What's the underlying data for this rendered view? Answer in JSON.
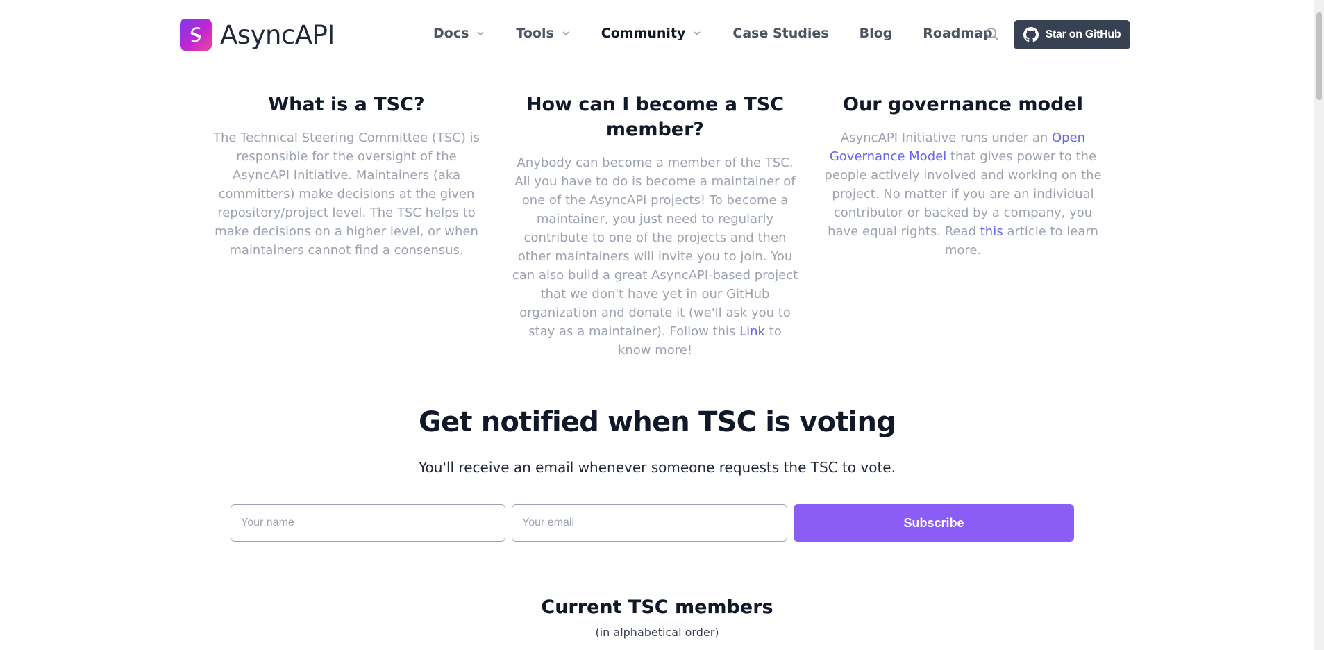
{
  "header": {
    "logo_text": "AsyncAPI",
    "nav": [
      {
        "label": "Docs",
        "dropdown": true
      },
      {
        "label": "Tools",
        "dropdown": true
      },
      {
        "label": "Community",
        "dropdown": true,
        "active": true
      },
      {
        "label": "Case Studies",
        "dropdown": false
      },
      {
        "label": "Blog",
        "dropdown": false
      },
      {
        "label": "Roadmap",
        "dropdown": false
      }
    ],
    "github_button": "Star on GitHub"
  },
  "info": {
    "tsc": {
      "title": "What is a TSC?",
      "body": "The Technical Steering Committee (TSC) is responsible for the oversight of the AsyncAPI Initiative. Maintainers (aka committers) make decisions at the given repository/project level. The TSC helps to make decisions on a higher level, or when maintainers cannot find a consensus."
    },
    "become": {
      "title": "How can I become a TSC member?",
      "body_before": "Anybody can become a member of the TSC. All you have to do is become a maintainer of one of the AsyncAPI projects! To become a maintainer, you just need to regularly contribute to one of the projects and then other maintainers will invite you to join. You can also build a great AsyncAPI-based project that we don't have yet in our GitHub organization and donate it (we'll ask you to stay as a maintainer). Follow this ",
      "link": "Link",
      "body_after": " to know more!"
    },
    "governance": {
      "title": "Our governance model",
      "body_1": "AsyncAPI Initiative runs under an ",
      "link_1": "Open Governance Model",
      "body_2": " that gives power to the people actively involved and working on the project. No matter if you are an individual contributor or backed by a company, you have equal rights. Read ",
      "link_2": "this",
      "body_3": " article to learn more."
    }
  },
  "notify": {
    "title": "Get notified when TSC is voting",
    "subtitle": "You'll receive an email whenever someone requests the TSC to vote.",
    "name_placeholder": "Your name",
    "email_placeholder": "Your email",
    "subscribe_label": "Subscribe"
  },
  "members": {
    "title": "Current TSC members",
    "subtitle": "(in alphabetical order)"
  },
  "colors": {
    "accent": "#8b5cf6",
    "link": "#6366f1",
    "github_button": "#374151"
  }
}
